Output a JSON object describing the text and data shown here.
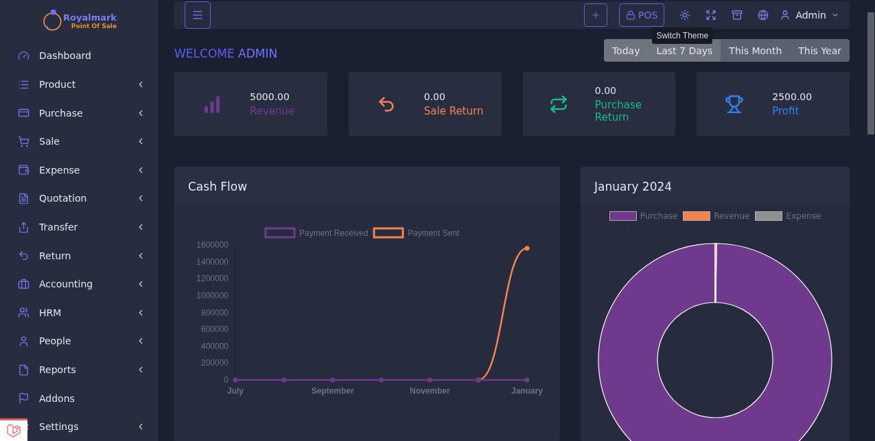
{
  "brand": {
    "name": "Royalmark",
    "tagline": "Point Of Sale"
  },
  "sidebar": {
    "items": [
      {
        "label": "Dashboard",
        "submenu": false
      },
      {
        "label": "Product",
        "submenu": true
      },
      {
        "label": "Purchase",
        "submenu": true
      },
      {
        "label": "Sale",
        "submenu": true
      },
      {
        "label": "Expense",
        "submenu": true
      },
      {
        "label": "Quotation",
        "submenu": true
      },
      {
        "label": "Transfer",
        "submenu": true
      },
      {
        "label": "Return",
        "submenu": true
      },
      {
        "label": "Accounting",
        "submenu": true
      },
      {
        "label": "HRM",
        "submenu": true
      },
      {
        "label": "People",
        "submenu": true
      },
      {
        "label": "Reports",
        "submenu": true
      },
      {
        "label": "Addons",
        "submenu": false
      },
      {
        "label": "Settings",
        "submenu": true
      }
    ]
  },
  "header": {
    "pos_button": "POS",
    "user": "Admin",
    "tooltip": "Switch Theme"
  },
  "welcome": {
    "text": "WELCOME",
    "name": "ADMIN"
  },
  "date_filters": [
    {
      "label": "Today",
      "selected": false
    },
    {
      "label": "Last 7 Days",
      "selected": false
    },
    {
      "label": "This Month",
      "selected": true
    },
    {
      "label": "This Year",
      "selected": true
    }
  ],
  "stats": [
    {
      "value": "5000.00",
      "label": "Revenue",
      "color": "#6f3a8e"
    },
    {
      "value": "0.00",
      "label": "Sale Return",
      "color": "#f4834f"
    },
    {
      "value": "0.00",
      "label": "Purchase Return",
      "color": "#1ab98a"
    },
    {
      "value": "2500.00",
      "label": "Profit",
      "color": "#2f80ed"
    }
  ],
  "cash_flow": {
    "title": "Cash Flow",
    "chart_data": {
      "type": "line",
      "categories": [
        "July",
        null,
        "September",
        null,
        "November",
        null,
        "January"
      ],
      "legend": "top",
      "ylim": [
        0,
        1600000
      ],
      "yticks": [
        0,
        200000,
        400000,
        600000,
        800000,
        1000000,
        1200000,
        1400000,
        1600000
      ],
      "series": [
        {
          "name": "Payment Received",
          "color": "#6f3a8e",
          "marker": "circle",
          "values": [
            0,
            0,
            0,
            0,
            0,
            0,
            0
          ]
        },
        {
          "name": "Payment Sent",
          "color": "#f4834f",
          "marker": "circle",
          "values": [
            null,
            null,
            null,
            null,
            null,
            0,
            1560000
          ]
        }
      ]
    }
  },
  "summary": {
    "title": "January 2024",
    "legend": [
      {
        "label": "Purchase",
        "color": "#6f3a8e"
      },
      {
        "label": "Revenue",
        "color": "#f4834f"
      },
      {
        "label": "Expense",
        "color": "#8a938f"
      }
    ]
  }
}
